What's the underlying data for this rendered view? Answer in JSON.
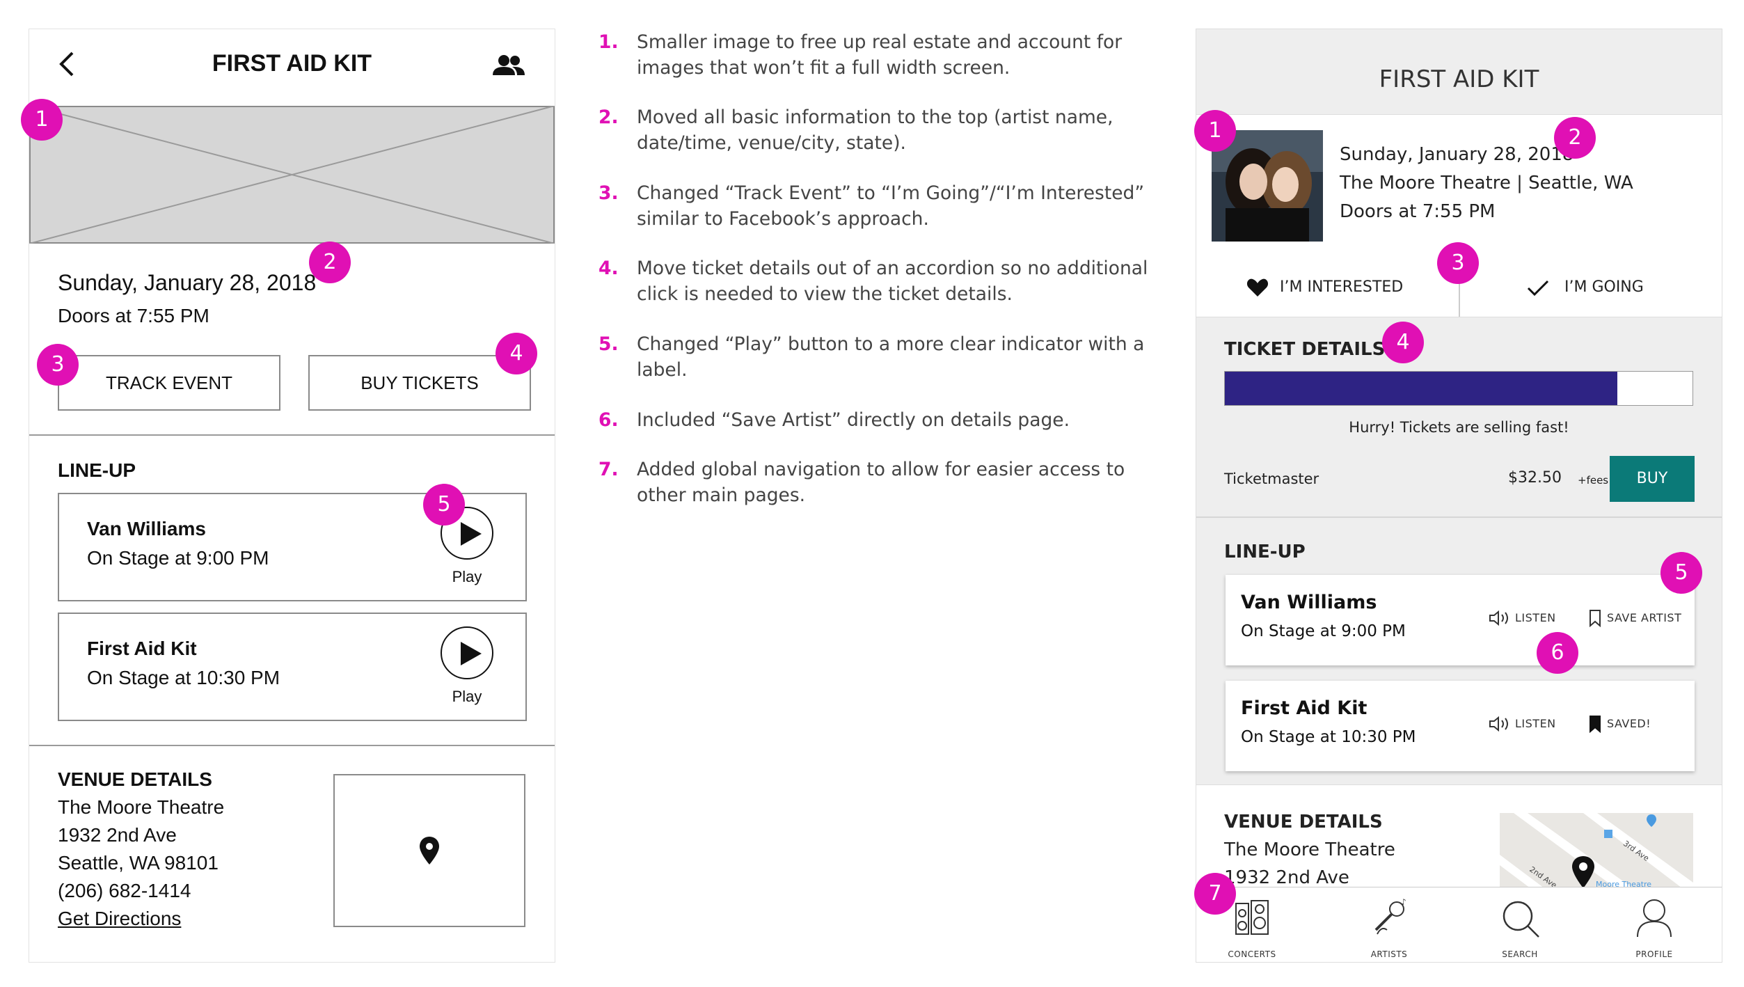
{
  "wireframe": {
    "header": {
      "back_icon": "chevron-left-icon",
      "title": "FIRST AID KIT",
      "people_icon": "group-icon"
    },
    "date": "Sunday, January 28, 2018",
    "doors": "Doors at 7:55 PM",
    "track_button": "TRACK EVENT",
    "buy_button": "BUY TICKETS",
    "lineup_title": "LINE-UP",
    "lineup": [
      {
        "name": "Van Williams",
        "time": "On Stage at 9:00 PM",
        "play": "Play"
      },
      {
        "name": "First Aid Kit",
        "time": "On Stage at 10:30 PM",
        "play": "Play"
      }
    ],
    "venue_title": "VENUE DETAILS",
    "venue_lines": [
      "The Moore Theatre",
      "1932 2nd Ave",
      "Seattle, WA 98101",
      "(206) 682-1414"
    ],
    "directions": "Get Directions"
  },
  "notes": [
    {
      "num": "1.",
      "text": "Smaller image to free up real estate and account for images that won’t fit a full width screen."
    },
    {
      "num": "2.",
      "text": "Moved all basic information to the top (artist name, date/time, venue/city, state)."
    },
    {
      "num": "3.",
      "text": "Changed “Track Event” to “I’m Going”/“I’m Interested” similar to Facebook’s approach."
    },
    {
      "num": "4.",
      "text": "Move ticket details out of an accordion so no additional click is needed to view the ticket details."
    },
    {
      "num": "5.",
      "text": "Changed “Play” button to a more clear indicator with a label."
    },
    {
      "num": "6.",
      "text": "Included “Save Artist” directly on details page."
    },
    {
      "num": "7.",
      "text": "Added global navigation to allow for easier access to other main pages."
    }
  ],
  "badges": {
    "b1": "1",
    "b2": "2",
    "b3": "3",
    "b4": "4",
    "b5": "5",
    "b6": "6",
    "b7": "7"
  },
  "mockup": {
    "title": "FIRST AID KIT",
    "date": "Sunday, January 28, 2018",
    "venue_city": "The Moore Theatre | Seattle, WA",
    "doors": "Doors at 7:55 PM",
    "interested": "I’M INTERESTED",
    "going": "I’M GOING",
    "ticket_title": "TICKET DETAILS",
    "sold_fraction": 0.84,
    "selling_fast": "Hurry! Tickets are selling fast!",
    "vendor": "Ticketmaster",
    "price": "$32.50",
    "fees": "+fees",
    "buy": "BUY",
    "lineup_title": "LINE-UP",
    "lineup": [
      {
        "name": "Van Williams",
        "time": "On Stage at 9:00 PM",
        "listen": "LISTEN",
        "save": "SAVE ARTIST"
      },
      {
        "name": "First Aid Kit",
        "time": "On Stage at 10:30 PM",
        "listen": "LISTEN",
        "save": "SAVED!"
      }
    ],
    "venue_title": "VENUE DETAILS",
    "venue_lines": [
      "The Moore Theatre",
      "1932 2nd Ave"
    ],
    "map_labels": {
      "a": "2nd Ave",
      "b": "3rd Ave",
      "c": "Moore Theatre"
    },
    "nav": [
      "CONCERTS",
      "ARTISTS",
      "SEARCH",
      "PROFILE"
    ],
    "colors": {
      "accent_purple": "#2e2384",
      "buy_teal": "#0b7a78",
      "badge_magenta": "#e010b4"
    }
  }
}
